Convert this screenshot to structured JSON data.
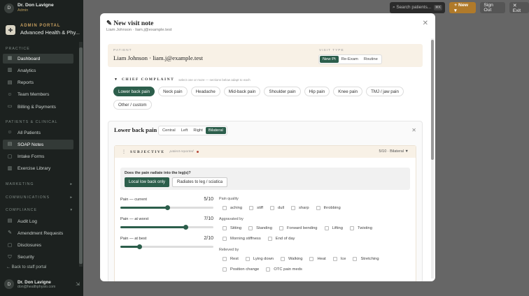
{
  "user": {
    "initial": "D",
    "name": "Dr. Don Lavigne",
    "role": "Admin",
    "email": "don@healthphysio.com"
  },
  "brand": {
    "top": "ADMIN PORTAL",
    "name": "Advanced Health & Phy..."
  },
  "sidebar": {
    "practice": {
      "title": "PRACTICE",
      "items": [
        {
          "label": "Dashboard",
          "icon": "dashboard-icon",
          "glyph": "▦"
        },
        {
          "label": "Analytics",
          "icon": "analytics-icon",
          "glyph": "▥"
        },
        {
          "label": "Reports",
          "icon": "reports-icon",
          "glyph": "▤"
        },
        {
          "label": "Team Members",
          "icon": "team-icon",
          "glyph": "☺"
        },
        {
          "label": "Billing & Payments",
          "icon": "billing-icon",
          "glyph": "▭"
        }
      ]
    },
    "patients": {
      "title": "PATIENTS & CLINICAL",
      "items": [
        {
          "label": "All Patients",
          "icon": "patients-icon",
          "glyph": "☺"
        },
        {
          "label": "SOAP Notes",
          "icon": "notes-icon",
          "glyph": "▤"
        },
        {
          "label": "Intake Forms",
          "icon": "forms-icon",
          "glyph": "▢"
        },
        {
          "label": "Exercise Library",
          "icon": "exercise-icon",
          "glyph": "▥"
        }
      ]
    },
    "marketing": {
      "title": "MARKETING",
      "chev": "▸"
    },
    "communications": {
      "title": "COMMUNICATIONS",
      "chev": "▸"
    },
    "compliance": {
      "title": "COMPLIANCE",
      "chev": "▾",
      "items": [
        {
          "label": "Audit Log",
          "icon": "audit-icon",
          "glyph": "▤"
        },
        {
          "label": "Amendment Requests",
          "icon": "amend-icon",
          "glyph": "✎"
        },
        {
          "label": "Disclosures",
          "icon": "disclosure-icon",
          "glyph": "▢"
        },
        {
          "label": "Security",
          "icon": "security-icon",
          "glyph": "⛉"
        }
      ]
    },
    "back": "← Back to staff portal"
  },
  "topbar": {
    "search": "Search patients...",
    "kbd": "⌘K",
    "new": "+ New ▾",
    "signout": "Sign Out",
    "exit": "✕ Exit"
  },
  "modal": {
    "title": "New visit note",
    "subtitle": "Liam Johnson · liam.j@example.test",
    "patient_label": "PATIENT",
    "patient": "Liam Johnson · liam.j@example.test",
    "visit_label": "VISIT TYPE",
    "visit_types": [
      "New Pt",
      "Re-Exam",
      "Routine"
    ],
    "cc_title": "CHIEF COMPLAINT",
    "cc_hint": "select one or more — sections below adapt to each",
    "complaints": [
      "Lower back pain",
      "Neck pain",
      "Headache",
      "Mid-back pain",
      "Shoulder pain",
      "Hip pain",
      "Knee pain",
      "TMJ / jaw pain",
      "Other / custom"
    ],
    "region": {
      "title": "Lower back pain",
      "sides": [
        "Central",
        "Left",
        "Right",
        "Bilateral"
      ],
      "subjective": {
        "title": "SUBJECTIVE",
        "hint": "patient-reported",
        "summary": "5/10 · Bilateral",
        "radiate_q": "Does the pain radiate into the leg(s)?",
        "radiate_yes": "Local low back only",
        "radiate_no": "Radiates to leg / sciatica",
        "sliders": [
          {
            "label": "Pain — current",
            "value_text": "5/10",
            "value": 5
          },
          {
            "label": "Pain — at worst",
            "value_text": "7/10",
            "value": 7
          },
          {
            "label": "Pain — at best",
            "value_text": "2/10",
            "value": 2
          }
        ],
        "quality_label": "Pain quality",
        "quality": [
          "aching",
          "stiff",
          "dull",
          "sharp",
          "throbbing"
        ],
        "aggravated_label": "Aggravated by",
        "aggravated": [
          "Sitting",
          "Standing",
          "Forward bending",
          "Lifting",
          "Twisting",
          "Morning stiffness",
          "End of day"
        ],
        "relieved_label": "Relieved by",
        "relieved": [
          "Rest",
          "Lying down",
          "Walking",
          "Heat",
          "Ice",
          "Stretching",
          "Position change",
          "OTC pain meds"
        ]
      }
    }
  }
}
